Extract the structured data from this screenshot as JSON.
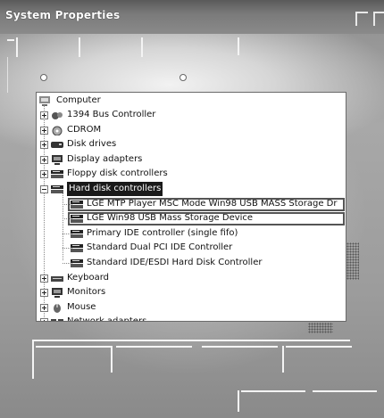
{
  "window": {
    "title": "System Properties"
  },
  "tree": {
    "root_label": "Computer",
    "items": [
      {
        "label": "1394 Bus Controller",
        "icon": "bus-controller-icon",
        "expander": "plus"
      },
      {
        "label": "CDROM",
        "icon": "cdrom-icon",
        "expander": "plus"
      },
      {
        "label": "Disk drives",
        "icon": "disk-drive-icon",
        "expander": "plus"
      },
      {
        "label": "Display adapters",
        "icon": "monitor-icon",
        "expander": "plus"
      },
      {
        "label": "Floppy disk controllers",
        "icon": "disk-controller-icon",
        "expander": "plus"
      },
      {
        "label": "Hard disk controllers",
        "icon": "disk-controller-icon",
        "expander": "minus",
        "selected": true
      },
      {
        "label": "LGE MTP Player MSC Mode Win98 USB MASS Storage Dr",
        "icon": "disk-controller-icon",
        "child": true,
        "highlight": true
      },
      {
        "label": "LGE Win98 USB Mass Storage Device",
        "icon": "disk-controller-icon",
        "child": true,
        "highlight": true
      },
      {
        "label": "Primary IDE controller (single fifo)",
        "icon": "disk-controller-icon",
        "child": true
      },
      {
        "label": "Standard Dual PCI IDE Controller",
        "icon": "disk-controller-icon",
        "child": true
      },
      {
        "label": "Standard IDE/ESDI Hard Disk Controller",
        "icon": "disk-controller-icon",
        "child": true
      },
      {
        "label": "Keyboard",
        "icon": "keyboard-icon",
        "expander": "plus"
      },
      {
        "label": "Monitors",
        "icon": "monitor-icon",
        "expander": "plus"
      },
      {
        "label": "Mouse",
        "icon": "mouse-icon",
        "expander": "plus"
      },
      {
        "label": "Network adapters",
        "icon": "network-icon",
        "expander": "plus"
      }
    ]
  }
}
